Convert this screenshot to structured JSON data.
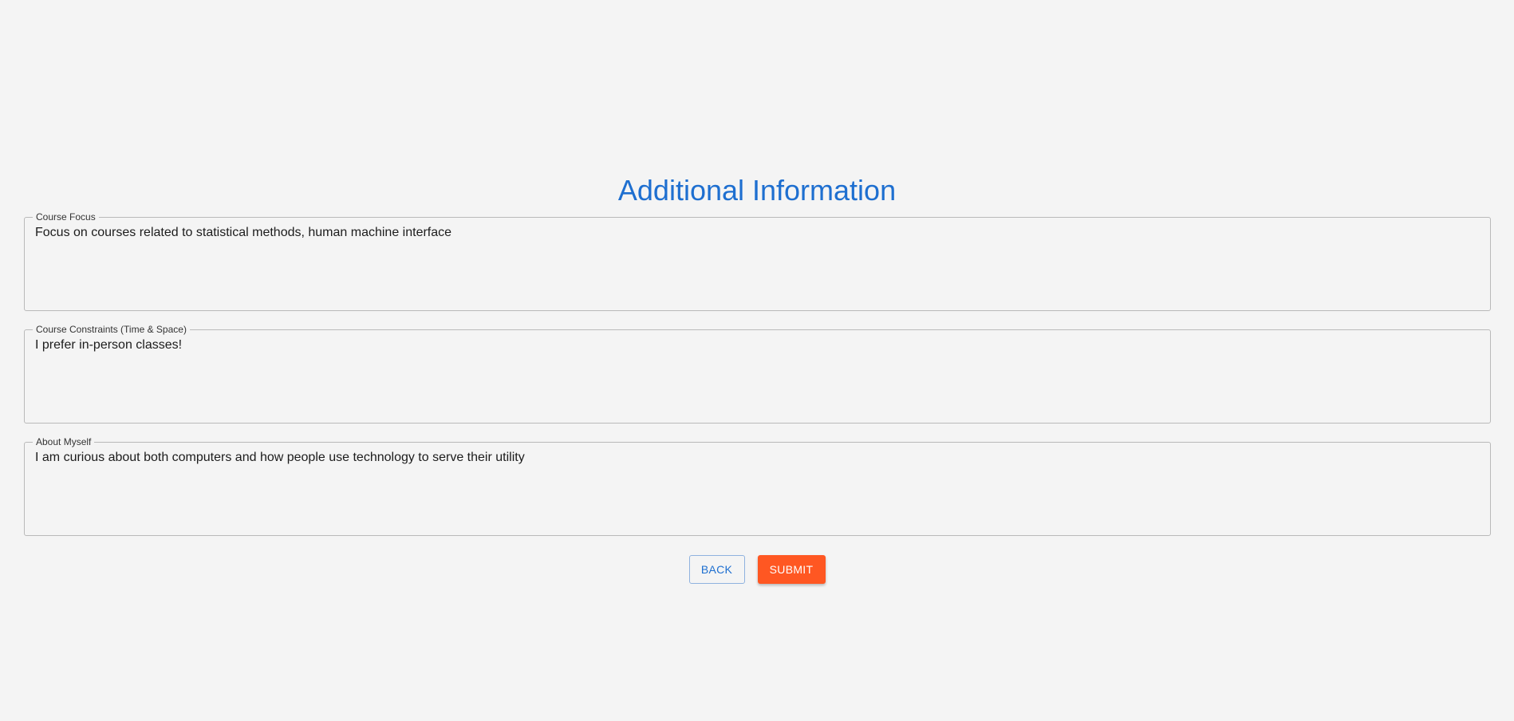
{
  "page": {
    "title": "Additional Information"
  },
  "form": {
    "course_focus": {
      "label": "Course Focus",
      "value": "Focus on courses related to statistical methods, human machine interface"
    },
    "course_constraints": {
      "label": "Course Constraints (Time & Space)",
      "value": "I prefer in-person classes!"
    },
    "about_myself": {
      "label": "About Myself",
      "value": "I am curious about both computers and how people use technology to serve their utility"
    }
  },
  "buttons": {
    "back_label": "BACK",
    "submit_label": "SUBMIT"
  },
  "colors": {
    "title": "#1e6fd0",
    "submit_bg": "#ff5722",
    "background": "#f4f4f4"
  }
}
